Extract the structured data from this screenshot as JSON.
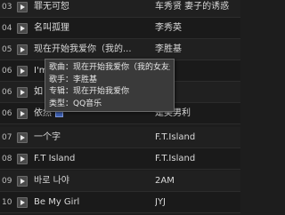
{
  "songs": [
    {
      "num": "03",
      "title": "罪无可恕",
      "artist": "车秀贤 妻子的诱惑"
    },
    {
      "num": "04",
      "title": "名叫孤狸",
      "artist": "李秀英"
    },
    {
      "num": "05",
      "title": "现在开始我爱你（我的...",
      "artist": "李胜基"
    },
    {
      "num": "06",
      "title": "I'm",
      "artist": ""
    },
    {
      "num": "06",
      "title": "如",
      "artist": ""
    },
    {
      "num": "06",
      "title": "依然",
      "artist": "是美男利"
    },
    {
      "num": "07",
      "title": "一个字",
      "artist": "F.T.Island"
    },
    {
      "num": "08",
      "title": "F.T Island",
      "artist": "F.T.Island"
    },
    {
      "num": "09",
      "title": "바로 나야",
      "artist": "2AM"
    },
    {
      "num": "10",
      "title": "Be My Girl",
      "artist": "JYJ"
    }
  ],
  "tooltip": {
    "song": "歌曲：现在开始我爱你（我的女友是九尾狐 插曲）",
    "singer": "歌手：李胜基",
    "album": "专辑：现在开始我爱你",
    "type": "类型：QQ音乐"
  }
}
